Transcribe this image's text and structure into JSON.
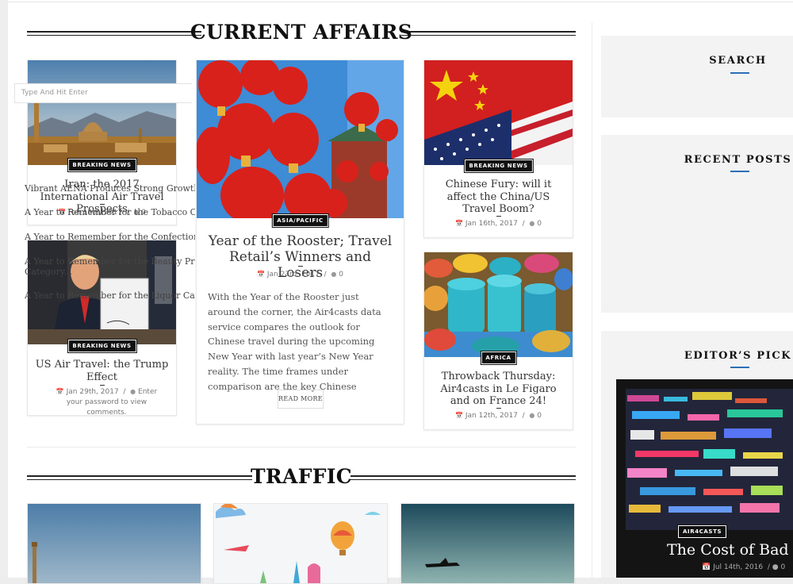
{
  "sections": {
    "current_affairs": "CURRENT AFFAIRS",
    "traffic": "TRAFFIC"
  },
  "cards": [
    {
      "badge": "BREAKING NEWS",
      "title": "Iran: the 2017 International Air Travel Prospects",
      "date": "Feb 10th, 2017",
      "comments": "0"
    },
    {
      "badge": "BREAKING NEWS",
      "title": "US Air Travel: the Trump Effect",
      "date": "Jan 29th, 2017",
      "comments": "Enter your password to view comments."
    },
    {
      "badge": "ASIA/PACIFIC",
      "title": "Year of the Rooster; Travel Retail’s Winners and Losers",
      "date": "Jan 23rd, 2017",
      "comments": "0",
      "excerpt": "With the Year of the Rooster just around the corner, the Air4casts data service compares the outlook for Chinese travel during the upcoming New Year with last year’s New Year reality. The time frames under comparison are the key Chinese",
      "read_more": "READ MORE"
    },
    {
      "badge": "BREAKING NEWS",
      "title": "Chinese Fury: will it affect the China/US Travel Boom?",
      "date": "Jan 16th, 2017",
      "comments": "0"
    },
    {
      "badge": "AFRICA",
      "title": "Throwback Thursday: Air4casts in Le Figaro and on France 24!",
      "date": "Jan 12th, 2017",
      "comments": "0"
    }
  ],
  "sidebar": {
    "search": {
      "title": "SEARCH",
      "placeholder": "Type And Hit Enter"
    },
    "recent": {
      "title": "RECENT POSTS",
      "items": [
        "Vibrant AENA Produces Strong Growth",
        "A Year to Remember for the Tobacco C",
        "A Year to Remember for the Confection",
        "A Year to Remember for the Beauty Pro",
        "Category...",
        "A Year to Remember for the Liquor Cat"
      ]
    },
    "editor": {
      "title": "EDITOR’S PICK",
      "badge": "AIR4CASTS",
      "post_title": "The Cost of Bad D",
      "date": "Jul 14th, 2016",
      "comments": "0"
    }
  },
  "icons": {
    "calendar": "calendar-icon",
    "comments": "comments-icon"
  },
  "colors": {
    "accent": "#2c6fb5",
    "badge_bg": "#111111"
  }
}
